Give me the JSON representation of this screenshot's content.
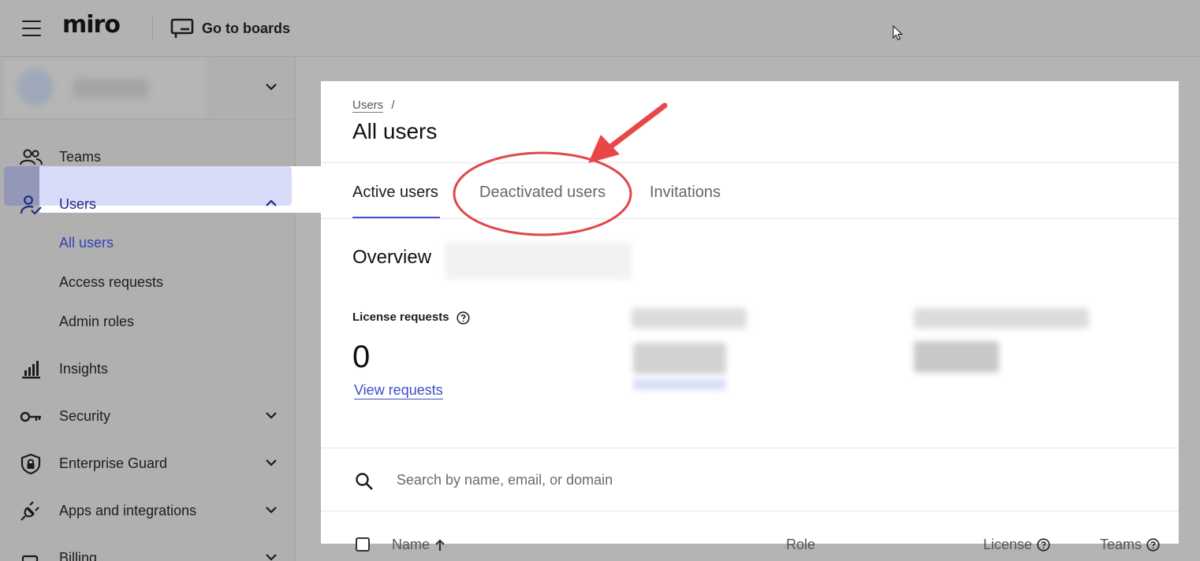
{
  "topbar": {
    "logo": "miro",
    "go_to_boards": "Go to boards"
  },
  "sidebar": {
    "items": [
      {
        "label": "Teams",
        "icon": "people-icon"
      },
      {
        "label": "Users",
        "icon": "user-check-icon",
        "expanded": true
      },
      {
        "label": "All users"
      },
      {
        "label": "Access requests"
      },
      {
        "label": "Admin roles"
      },
      {
        "label": "Insights",
        "icon": "bar-chart-icon"
      },
      {
        "label": "Security",
        "icon": "key-icon"
      },
      {
        "label": "Enterprise Guard",
        "icon": "shield-lock-icon"
      },
      {
        "label": "Apps and integrations",
        "icon": "plug-icon"
      },
      {
        "label": "Billing",
        "icon": "billing-icon"
      }
    ]
  },
  "main": {
    "breadcrumb": {
      "parent": "Users",
      "separator": "/"
    },
    "title": "All users",
    "tabs": [
      {
        "label": "Active users",
        "active": true
      },
      {
        "label": "Deactivated users",
        "active": false
      },
      {
        "label": "Invitations",
        "active": false
      }
    ],
    "overview": {
      "heading": "Overview",
      "license_requests": {
        "label": "License requests",
        "count": "0",
        "link": "View requests"
      }
    },
    "search": {
      "placeholder": "Search by name, email, or domain"
    },
    "table": {
      "columns": [
        {
          "label": "Name"
        },
        {
          "label": "Role"
        },
        {
          "label": "License"
        },
        {
          "label": "Teams"
        }
      ]
    }
  },
  "colors": {
    "accent": "#4254d6",
    "annotation": "#e8474a",
    "selected_bg": "#d9dcf8"
  }
}
